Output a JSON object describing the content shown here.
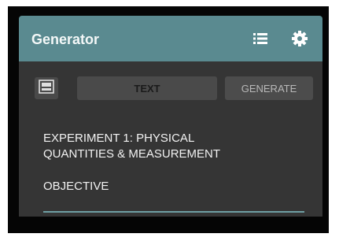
{
  "appbar": {
    "title": "Generator",
    "icons": [
      "list-icon",
      "gear-icon"
    ]
  },
  "toolbar": {
    "image_icon": "image-icon",
    "text_label": "TEXT",
    "generate_label": "GENERATE"
  },
  "content": {
    "heading_line1": "EXPERIMENT 1: PHYSICAL",
    "heading_line2": "QUANTITIES & MEASUREMENT",
    "objective": "OBJECTIVE"
  },
  "colors": {
    "appbar": "#5a8a90",
    "panel": "#353535",
    "button": "#4a4a4a",
    "accent_line": "#6e9ea3"
  }
}
